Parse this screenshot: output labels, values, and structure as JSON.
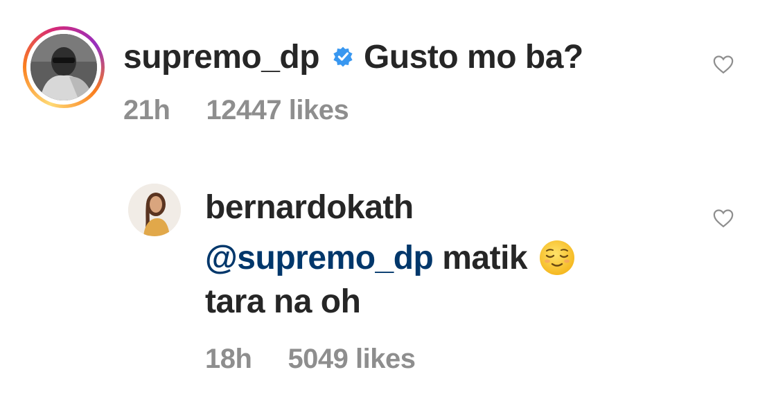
{
  "comment": {
    "username": "supremo_dp",
    "verified_icon": "verified-badge-icon",
    "text": "Gusto mo ba?",
    "time": "21h",
    "likes": "12447 likes",
    "like_icon": "heart-outline-icon",
    "ring_colors": [
      "#feda75",
      "#fa7e1e",
      "#d62976",
      "#962fbf"
    ]
  },
  "reply": {
    "username": "bernardokath",
    "mention": "@supremo_dp",
    "text_after_mention": "matik",
    "emoji": "relieved-face-emoji",
    "text_line2": "tara na oh",
    "time": "18h",
    "likes": "5049 likes",
    "like_icon": "heart-outline-icon"
  },
  "colors": {
    "text": "#262626",
    "secondary": "#8e8e8e",
    "mention": "#00376b",
    "verified": "#3897f0"
  }
}
